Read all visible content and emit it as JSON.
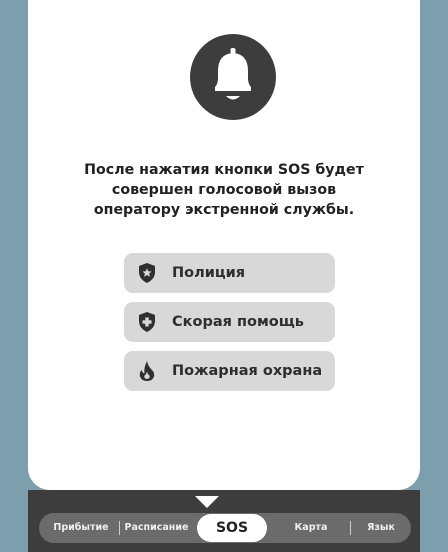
{
  "message": {
    "line1": "После нажатия кнопки SOS будет",
    "line2": "совершен голосовой вызов",
    "line3": "оператору экстренной службы."
  },
  "services": [
    {
      "label": "Полиция",
      "icon": "police-shield-icon"
    },
    {
      "label": "Скорая помощь",
      "icon": "medical-shield-icon"
    },
    {
      "label": "Пожарная охрана",
      "icon": "fire-icon"
    }
  ],
  "tabs": [
    {
      "label": "Прибытие"
    },
    {
      "label": "Расписание"
    },
    {
      "label": "SOS",
      "active": true
    },
    {
      "label": "Карта"
    },
    {
      "label": "Язык"
    }
  ],
  "colors": {
    "background": "#7d9fad",
    "dark": "#3d3d3d",
    "button": "#d8d8d8",
    "tab_pill": "#6b6b6b"
  }
}
